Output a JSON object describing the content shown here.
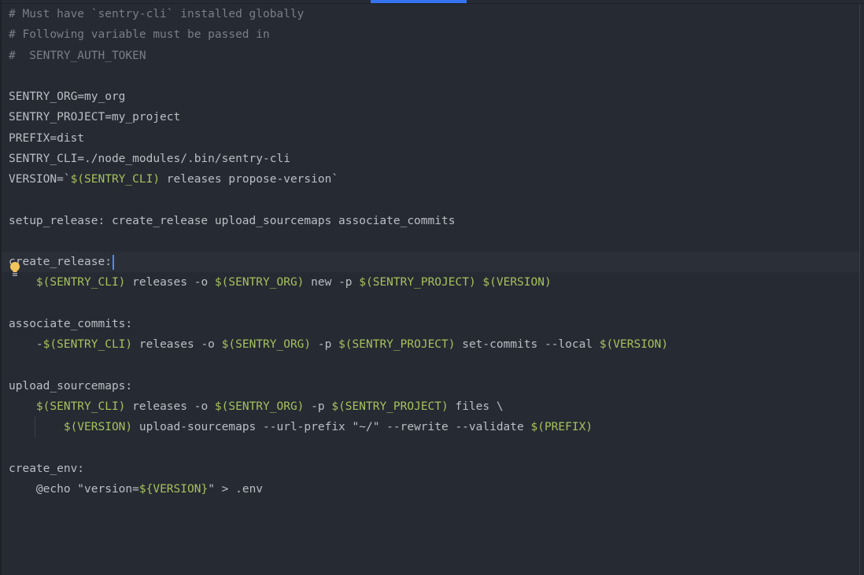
{
  "editor": {
    "lines": [
      [
        {
          "t": "# Must have `sentry-cli` installed globally",
          "c": "cmt"
        }
      ],
      [
        {
          "t": "# Following variable must be passed in",
          "c": "cmt"
        }
      ],
      [
        {
          "t": "#  SENTRY_AUTH_TOKEN",
          "c": "cmt"
        }
      ],
      [],
      [
        {
          "t": "SENTRY_ORG=my_org",
          "c": "txt"
        }
      ],
      [
        {
          "t": "SENTRY_PROJECT=my_project",
          "c": "txt"
        }
      ],
      [
        {
          "t": "PREFIX=dist",
          "c": "txt"
        }
      ],
      [
        {
          "t": "SENTRY_CLI=./node_modules/.bin/sentry-cli",
          "c": "txt"
        }
      ],
      [
        {
          "t": "VERSION=`",
          "c": "txt"
        },
        {
          "t": "$(SENTRY_CLI)",
          "c": "var"
        },
        {
          "t": " releases propose-version`",
          "c": "txt"
        }
      ],
      [],
      [
        {
          "t": "setup_release: create_release upload_sourcemaps associate_commits",
          "c": "txt"
        }
      ],
      [],
      [
        {
          "t": "create_release:",
          "c": "txt"
        }
      ],
      [
        {
          "t": "    ",
          "c": "txt"
        },
        {
          "t": "$(SENTRY_CLI)",
          "c": "var"
        },
        {
          "t": " releases -o ",
          "c": "txt"
        },
        {
          "t": "$(SENTRY_ORG)",
          "c": "var"
        },
        {
          "t": " new -p ",
          "c": "txt"
        },
        {
          "t": "$(SENTRY_PROJECT)",
          "c": "var"
        },
        {
          "t": " ",
          "c": "txt"
        },
        {
          "t": "$(VERSION)",
          "c": "var"
        }
      ],
      [],
      [
        {
          "t": "associate_commits:",
          "c": "txt"
        }
      ],
      [
        {
          "t": "    -",
          "c": "txt"
        },
        {
          "t": "$(SENTRY_CLI)",
          "c": "var"
        },
        {
          "t": " releases -o ",
          "c": "txt"
        },
        {
          "t": "$(SENTRY_ORG)",
          "c": "var"
        },
        {
          "t": " -p ",
          "c": "txt"
        },
        {
          "t": "$(SENTRY_PROJECT)",
          "c": "var"
        },
        {
          "t": " set-commits --local ",
          "c": "txt"
        },
        {
          "t": "$(VERSION)",
          "c": "var"
        }
      ],
      [],
      [
        {
          "t": "upload_sourcemaps:",
          "c": "txt"
        }
      ],
      [
        {
          "t": "    ",
          "c": "txt"
        },
        {
          "t": "$(SENTRY_CLI)",
          "c": "var"
        },
        {
          "t": " releases -o ",
          "c": "txt"
        },
        {
          "t": "$(SENTRY_ORG)",
          "c": "var"
        },
        {
          "t": " -p ",
          "c": "txt"
        },
        {
          "t": "$(SENTRY_PROJECT)",
          "c": "var"
        },
        {
          "t": " files \\",
          "c": "txt"
        }
      ],
      [
        {
          "t": "        ",
          "c": "txt"
        },
        {
          "t": "$(VERSION)",
          "c": "var"
        },
        {
          "t": " upload-sourcemaps --url-prefix \"~/\" --rewrite --validate ",
          "c": "txt"
        },
        {
          "t": "$(PREFIX)",
          "c": "var"
        }
      ],
      [],
      [
        {
          "t": "create_env:",
          "c": "txt"
        }
      ],
      [
        {
          "t": "    @echo \"version=",
          "c": "txt"
        },
        {
          "t": "${VERSION}",
          "c": "var"
        },
        {
          "t": "\" > .env",
          "c": "txt"
        }
      ]
    ],
    "current_line": 12,
    "caret_line": 12,
    "bulb_icon": "lightbulb-icon",
    "colors": {
      "background": "#262a33",
      "comment": "#7a7e85",
      "variable": "#a5c25c",
      "text": "#bcbec4",
      "caret": "#4c8bf5",
      "tab_accent": "#3574f0",
      "bulb": "#f2c55c"
    }
  }
}
